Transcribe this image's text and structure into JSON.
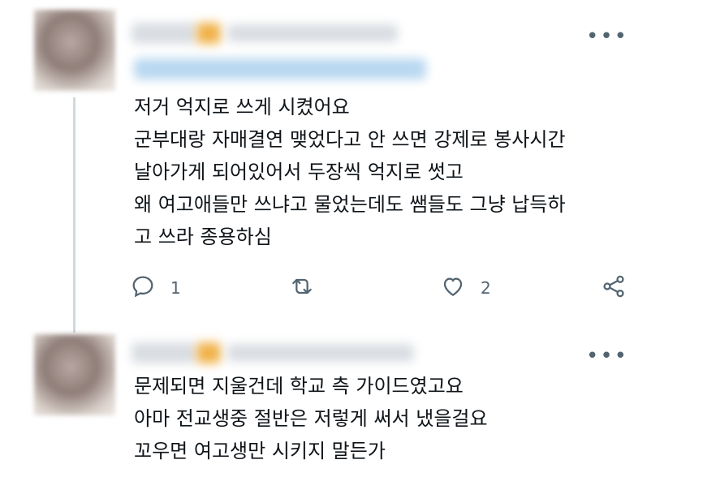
{
  "tweet1": {
    "text_lines": [
      "저거 억지로 쓰게 시켰어요",
      "군부대랑 자매결연 맺었다고 안 쓰면 강제로 봉사시간",
      "날아가게 되어있어서 두장씩 억지로 썻고",
      "왜 여고애들만 쓰냐고 물었는데도 쌤들도 그냥 납득하",
      "고 쓰라 종용하심"
    ],
    "more_label": "•••",
    "actions": {
      "reply_count": "1",
      "retweet_count": "",
      "like_count": "2"
    },
    "icons": {
      "reply": "reply-icon",
      "retweet": "retweet-icon",
      "like": "heart-icon",
      "share": "share-icon"
    }
  },
  "tweet2": {
    "text_lines": [
      "문제되면 지울건데 학교 측 가이드였고요",
      "아마 전교생중 절반은 저렇게 써서 냈을걸요",
      "꼬우면 여고생만 시키지 말든가"
    ],
    "more_label": "•••"
  },
  "colors": {
    "text": "#0f1419",
    "icon_gray": "#536471",
    "thread_line": "#cfd9de"
  }
}
